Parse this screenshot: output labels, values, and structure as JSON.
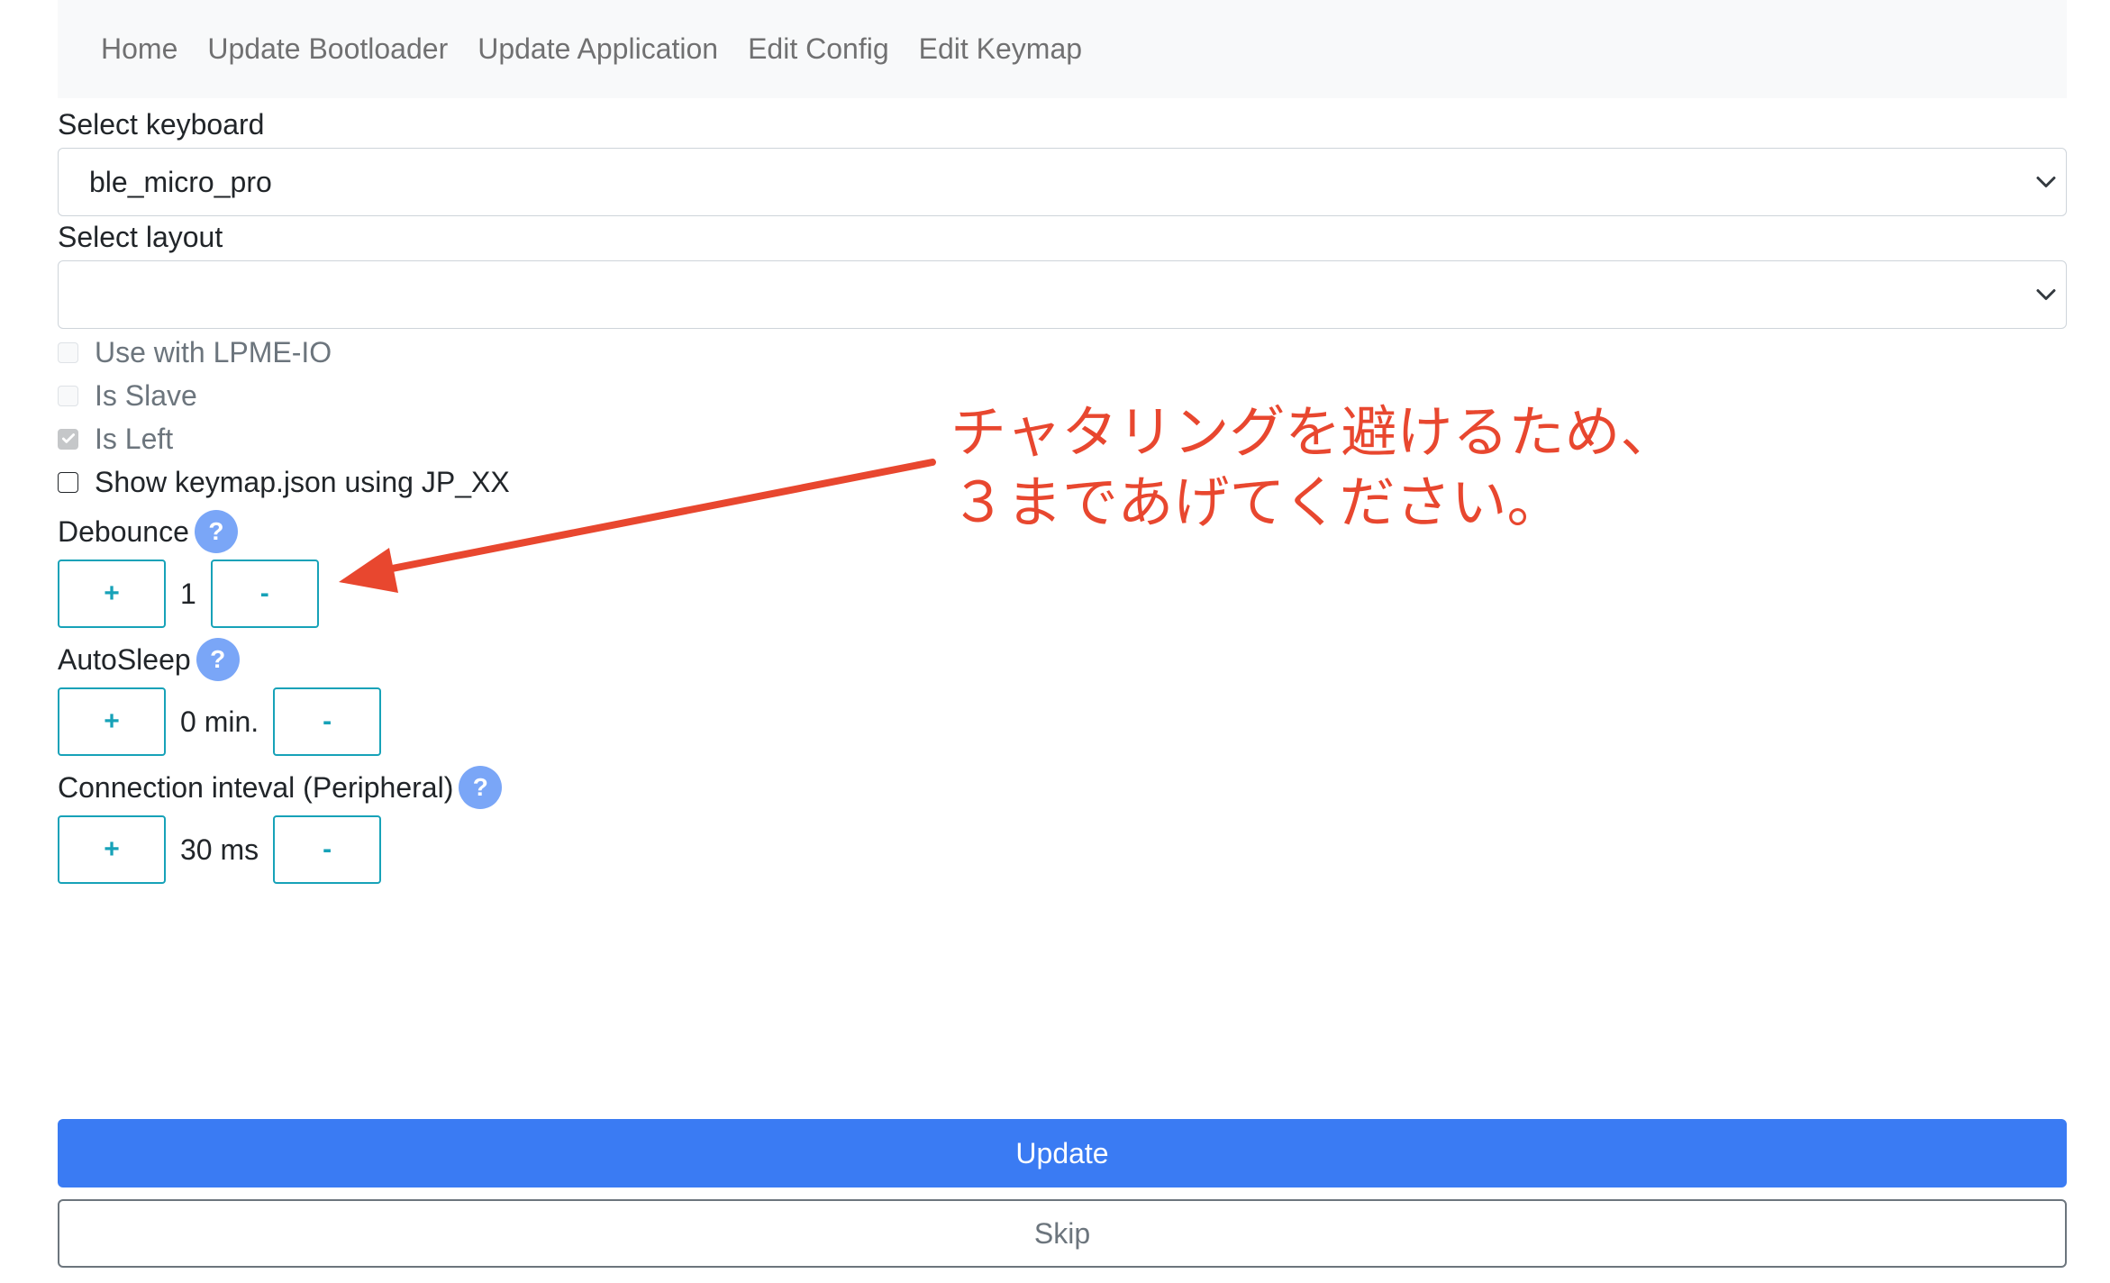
{
  "nav": {
    "items": [
      "Home",
      "Update Bootloader",
      "Update Application",
      "Edit Config",
      "Edit Keymap"
    ]
  },
  "form": {
    "keyboard_label": "Select keyboard",
    "keyboard_value": "ble_micro_pro",
    "layout_label": "Select layout",
    "layout_value": "",
    "checkboxes": {
      "lpme": {
        "label": "Use with LPME-IO",
        "checked": false,
        "disabled": true
      },
      "slave": {
        "label": "Is Slave",
        "checked": false,
        "disabled": true
      },
      "left": {
        "label": "Is Left",
        "checked": true,
        "disabled": true
      },
      "jp": {
        "label": "Show keymap.json using JP_XX",
        "checked": false,
        "disabled": false
      }
    }
  },
  "settings": {
    "debounce": {
      "title": "Debounce",
      "value": "1",
      "plus": "+",
      "minus": "-"
    },
    "autosleep": {
      "title": "AutoSleep",
      "value": "0 min.",
      "plus": "+",
      "minus": "-"
    },
    "interval": {
      "title": "Connection inteval (Peripheral)",
      "value": "30 ms",
      "plus": "+",
      "minus": "-"
    },
    "help_glyph": "?"
  },
  "buttons": {
    "update": "Update",
    "skip": "Skip"
  },
  "annotation": {
    "line1": "チャタリングを避けるため、",
    "line2": "３まであげてください。",
    "color": "#e8472f"
  },
  "colors": {
    "primary": "#3a7bf3",
    "stepper_border": "#17a2b8",
    "help_icon": "#7aa6f7"
  }
}
